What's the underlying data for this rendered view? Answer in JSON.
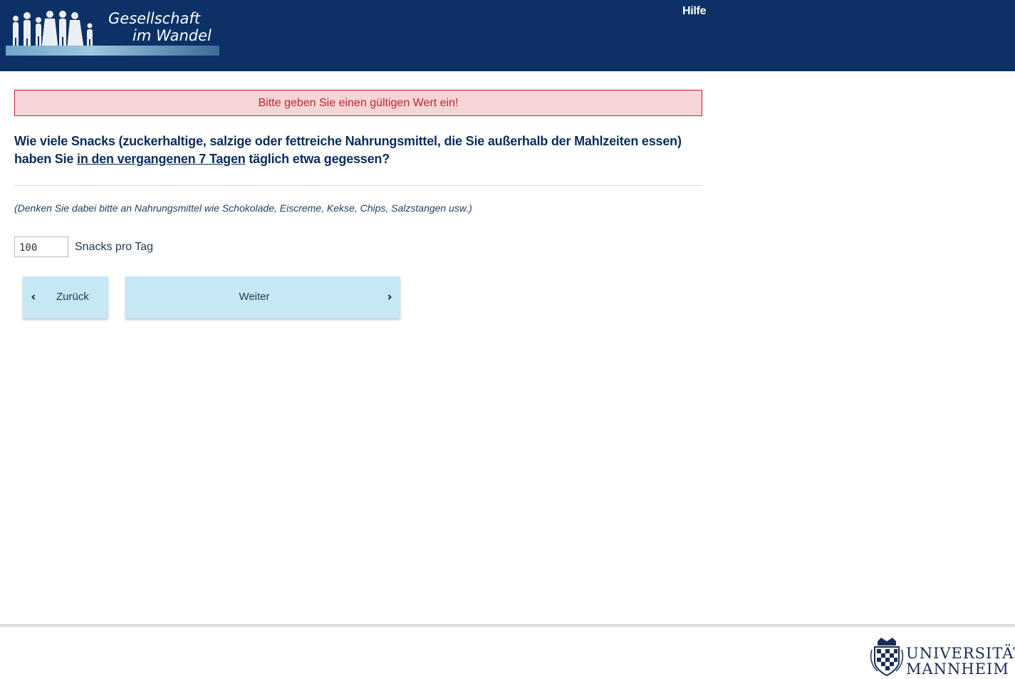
{
  "header": {
    "logo_line1": "Gesellschaft",
    "logo_line2": "im Wandel",
    "help_label": "Hilfe"
  },
  "error_message": "Bitte geben Sie einen gültigen Wert ein!",
  "question": {
    "text_before": "Wie viele Snacks (zuckerhaltige, salzige oder fettreiche Nahrungsmittel, die Sie außerhalb der Mahlzeiten essen) haben Sie ",
    "text_emphasis": "in den vergangenen 7 Tagen",
    "text_after": " täglich etwa gegessen?",
    "hint": "(Denken Sie dabei bitte an Nahrungsmittel wie Schokolade, Eiscreme, Kekse, Chips, Salzstangen usw.)"
  },
  "answer": {
    "value": "100",
    "unit_label": "Snacks pro Tag"
  },
  "navigation": {
    "back_label": "Zurück",
    "next_label": "Weiter"
  },
  "footer": {
    "university_line1": "UNIVERSITÄT",
    "university_line2": "MANNHEIM"
  },
  "colors": {
    "header_bg": "#0b3166",
    "error_bg": "#f5d5d8",
    "error_text": "#c0242e",
    "question_text": "#0b2d5b",
    "button_bg": "#c6e7f4"
  }
}
